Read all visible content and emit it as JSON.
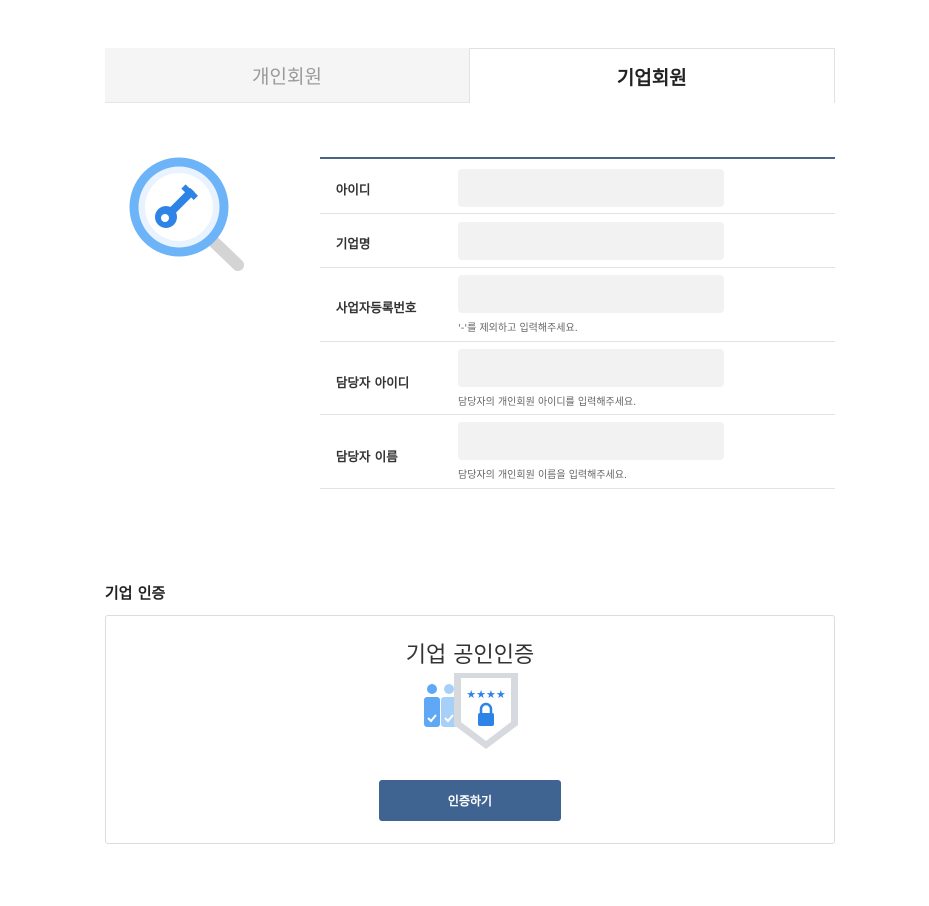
{
  "tabs": [
    {
      "label": "개인회원",
      "active": false
    },
    {
      "label": "기업회원",
      "active": true
    }
  ],
  "form": {
    "fields": [
      {
        "label": "아이디",
        "value": "",
        "hint": ""
      },
      {
        "label": "기업명",
        "value": "",
        "hint": ""
      },
      {
        "label": "사업자등록번호",
        "value": "",
        "hint": "'-'를 제외하고 입력해주세요."
      },
      {
        "label": "담당자 아이디",
        "value": "",
        "hint": "담당자의 개인회원 아이디를 입력해주세요."
      },
      {
        "label": "담당자 이름",
        "value": "",
        "hint": "담당자의 개인회원 이름을 입력해주세요."
      }
    ]
  },
  "certification": {
    "section_title": "기업 인증",
    "heading": "기업 공인인증",
    "stars": "★★★★",
    "button_label": "인증하기"
  },
  "colors": {
    "accent": "#3f6491",
    "form_border": "#4a6384",
    "icon_blue": "#5fa8f5",
    "input_bg": "#f2f2f2"
  },
  "icons": {
    "search_key": "key-magnifier-icon",
    "cert": "certificate-shield-icon"
  }
}
